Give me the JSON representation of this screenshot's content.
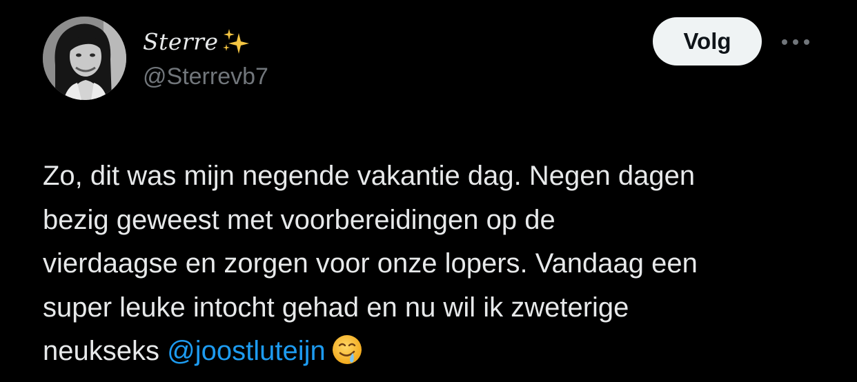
{
  "author": {
    "display_name": "Sterre",
    "display_name_icon": "sparkles-icon",
    "handle": "@Sterrevb7",
    "avatar": "profile-photo"
  },
  "actions": {
    "follow_label": "Volg",
    "more_icon": "more-options-icon"
  },
  "tweet": {
    "lines": [
      "Zo, dit was mijn negende vakantie dag. Negen dagen",
      "bezig geweest met voorbereidingen op de",
      "vierdaagse en zorgen voor onze lopers. Vandaag een",
      "super leuke intocht gehad en nu wil ik zweterige"
    ],
    "last_line_text": "neukseks",
    "mention": "@joostluteijn",
    "emoji": "drooling-face-emoji"
  },
  "colors": {
    "background": "#000000",
    "text": "#e7e9ea",
    "secondary_text": "#71767b",
    "mention": "#1d9bf0",
    "follow_bg": "#eff3f4",
    "follow_text": "#0f1419"
  }
}
